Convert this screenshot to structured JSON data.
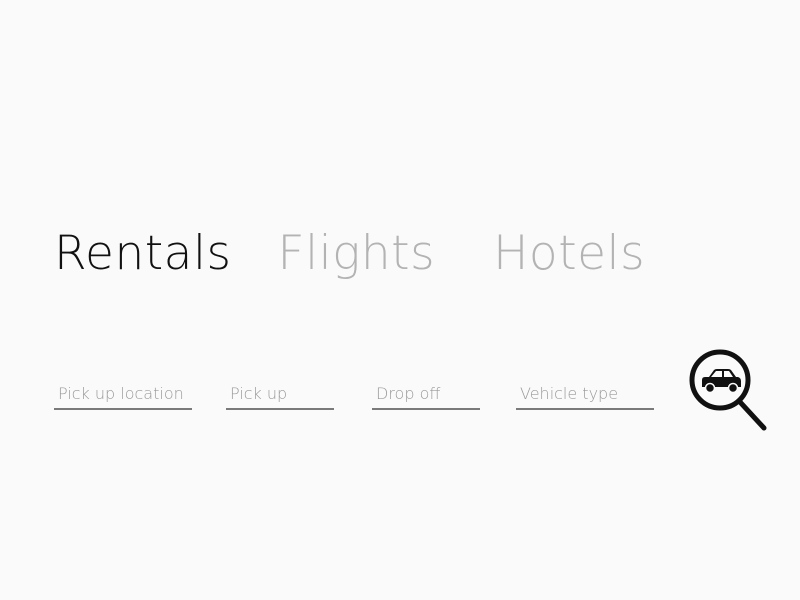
{
  "tabs": [
    {
      "label": "Rentals",
      "active": true
    },
    {
      "label": "Flights",
      "active": false
    },
    {
      "label": "Hotels",
      "active": false
    }
  ],
  "form": {
    "pickup_location_placeholder": "Pick up location",
    "pickup_placeholder": "Pick up",
    "dropoff_placeholder": "Drop off",
    "vehicle_type_placeholder": "Vehicle type"
  },
  "search_button": {
    "icon": "car-search-icon"
  },
  "colors": {
    "background": "#fafafa",
    "active_tab": "#111111",
    "inactive_tab": "#b3b3b3",
    "field_underline": "#7a7a7a",
    "placeholder": "#9a9a9a"
  }
}
